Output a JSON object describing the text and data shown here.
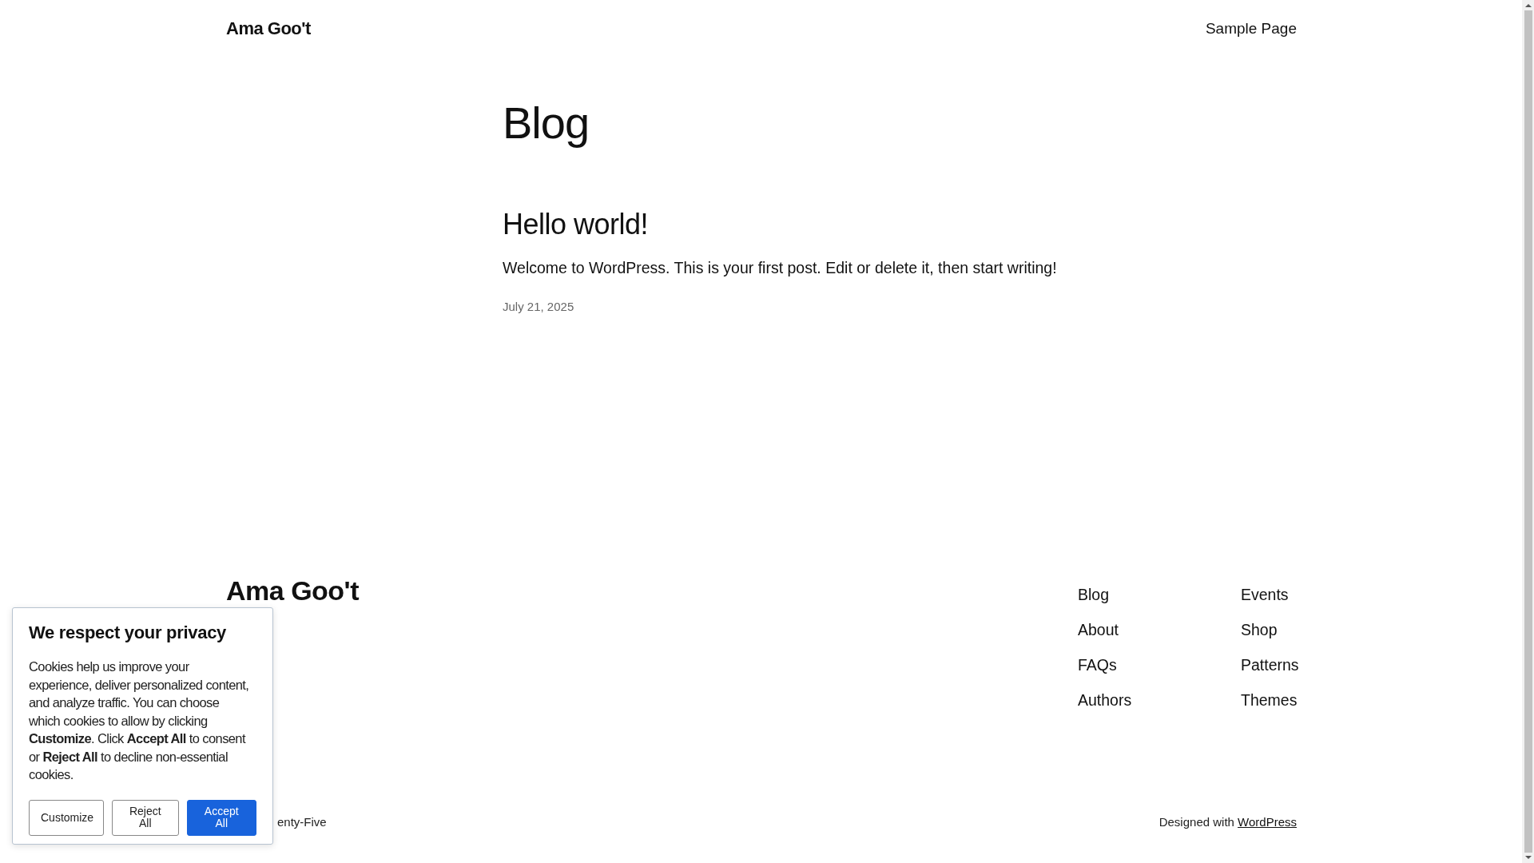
{
  "header": {
    "site_title": "Ama Goo't",
    "nav": [
      "Sample Page"
    ]
  },
  "main": {
    "heading": "Blog",
    "posts": [
      {
        "title": "Hello world!",
        "excerpt": "Welcome to WordPress. This is your first post. Edit or delete it, then start writing!",
        "date": "July 21, 2025"
      }
    ]
  },
  "footer": {
    "site_title": "Ama Goo't",
    "nav_columns": [
      [
        "Blog",
        "About",
        "FAQs",
        "Authors"
      ],
      [
        "Events",
        "Shop",
        "Patterns",
        "Themes"
      ]
    ],
    "credit_left": "enty-Five",
    "credit_right": {
      "text": "Designed with",
      "link": "WordPress"
    }
  },
  "cookie_banner": {
    "title": "We respect your privacy",
    "body": "Cookies help us improve your experience, deliver personalized content, and analyze traffic. You can choose which cookies to allow by clicking **Customize**. Click **Accept All** to consent or **Reject All** to decline non-essential cookies.",
    "buttons": [
      {
        "label": "Customize",
        "kind": "outline"
      },
      {
        "label": "Reject All",
        "kind": "outline"
      },
      {
        "label": "Accept All",
        "kind": "primary"
      }
    ]
  }
}
